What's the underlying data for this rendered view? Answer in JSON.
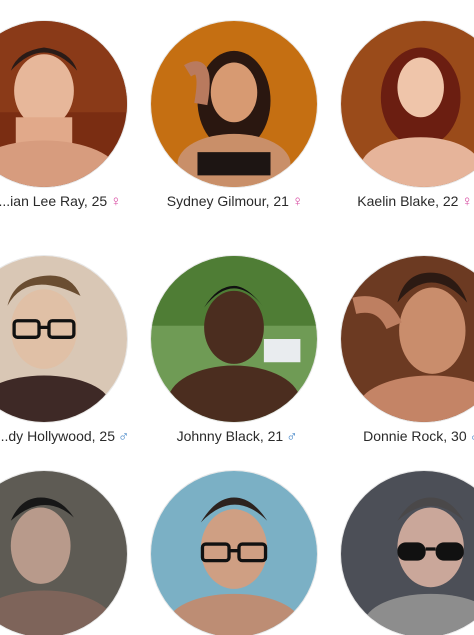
{
  "profiles": [
    {
      "name": "...ian Lee Ray, 25",
      "gender_symbol": "♀",
      "gender": "female",
      "photo_icon": "woman-avatar-icon"
    },
    {
      "name": "Sydney Gilmour, 21",
      "gender_symbol": "♀",
      "gender": "female",
      "photo_icon": "woman-avatar-icon"
    },
    {
      "name": "Kaelin Blake, 22",
      "gender_symbol": "♀",
      "gender": "female",
      "photo_icon": "woman-avatar-icon"
    },
    {
      "name": "...dy Hollywood, 25",
      "gender_symbol": "♂",
      "gender": "male",
      "photo_icon": "man-avatar-icon"
    },
    {
      "name": "Johnny Black, 21",
      "gender_symbol": "♂",
      "gender": "male",
      "photo_icon": "man-avatar-icon"
    },
    {
      "name": "Donnie Rock, 30",
      "gender_symbol": "♂",
      "gender": "male",
      "photo_icon": "man-avatar-icon"
    },
    {
      "name": "",
      "gender_symbol": "",
      "gender": "male",
      "photo_icon": "man-avatar-icon"
    },
    {
      "name": "",
      "gender_symbol": "",
      "gender": "male",
      "photo_icon": "man-avatar-icon"
    },
    {
      "name": "",
      "gender_symbol": "",
      "gender": "male",
      "photo_icon": "man-avatar-icon"
    }
  ],
  "colors": {
    "female_symbol": "#d84aa2",
    "male_symbol": "#3f82c6"
  }
}
